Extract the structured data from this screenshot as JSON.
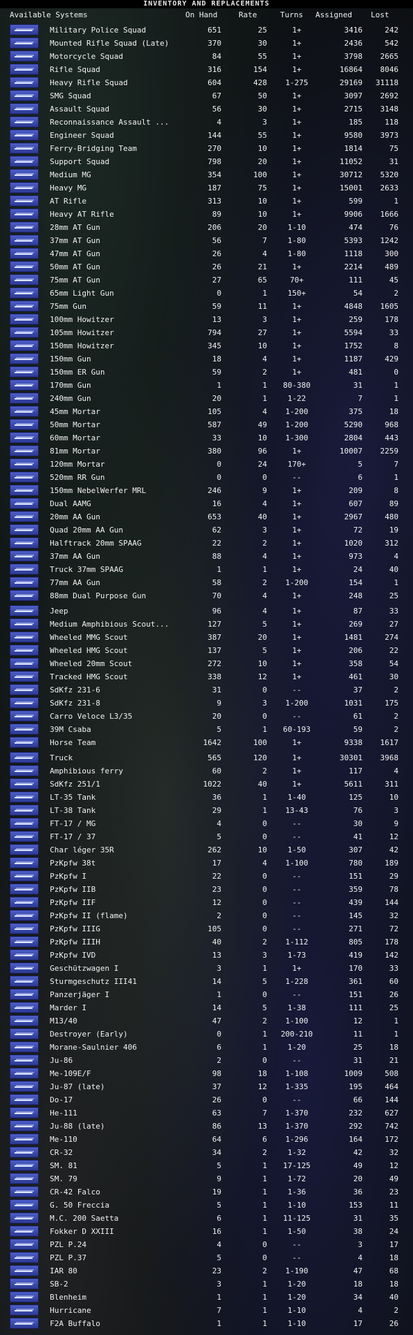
{
  "title": "INVENTORY AND REPLACEMENTS",
  "headers": {
    "name": "Available Systems",
    "on_hand": "On Hand",
    "rate": "Rate",
    "turns": "Turns",
    "assigned": "Assigned",
    "lost": "Lost"
  },
  "rows": [
    {
      "name": "Military Police Squad",
      "on_hand": "651",
      "rate": "25",
      "turns": "1+",
      "assigned": "3416",
      "lost": "242"
    },
    {
      "name": "Mounted Rifle Squad (Late)",
      "on_hand": "370",
      "rate": "30",
      "turns": "1+",
      "assigned": "2436",
      "lost": "542"
    },
    {
      "name": "Motorcycle Squad",
      "on_hand": "84",
      "rate": "55",
      "turns": "1+",
      "assigned": "3798",
      "lost": "2665"
    },
    {
      "name": "Rifle Squad",
      "on_hand": "316",
      "rate": "154",
      "turns": "1+",
      "assigned": "16864",
      "lost": "8046"
    },
    {
      "name": "Heavy Rifle Squad",
      "on_hand": "604",
      "rate": "428",
      "turns": "1-275",
      "assigned": "29169",
      "lost": "31118"
    },
    {
      "name": "SMG Squad",
      "on_hand": "67",
      "rate": "50",
      "turns": "1+",
      "assigned": "3097",
      "lost": "2692"
    },
    {
      "name": "Assault Squad",
      "on_hand": "56",
      "rate": "30",
      "turns": "1+",
      "assigned": "2715",
      "lost": "3148"
    },
    {
      "name": "Reconnaissance Assault ...",
      "on_hand": "4",
      "rate": "3",
      "turns": "1+",
      "assigned": "185",
      "lost": "118"
    },
    {
      "name": "Engineer Squad",
      "on_hand": "144",
      "rate": "55",
      "turns": "1+",
      "assigned": "9580",
      "lost": "3973"
    },
    {
      "name": "Ferry-Bridging Team",
      "on_hand": "270",
      "rate": "10",
      "turns": "1+",
      "assigned": "1814",
      "lost": "75"
    },
    {
      "name": "Support Squad",
      "on_hand": "798",
      "rate": "20",
      "turns": "1+",
      "assigned": "11052",
      "lost": "31"
    },
    {
      "name": "Medium MG",
      "on_hand": "354",
      "rate": "100",
      "turns": "1+",
      "assigned": "30712",
      "lost": "5320"
    },
    {
      "name": "Heavy MG",
      "on_hand": "187",
      "rate": "75",
      "turns": "1+",
      "assigned": "15001",
      "lost": "2633"
    },
    {
      "name": "AT Rifle",
      "on_hand": "313",
      "rate": "10",
      "turns": "1+",
      "assigned": "599",
      "lost": "1"
    },
    {
      "name": "Heavy AT Rifle",
      "on_hand": "89",
      "rate": "10",
      "turns": "1+",
      "assigned": "9906",
      "lost": "1666"
    },
    {
      "name": "28mm AT Gun",
      "on_hand": "206",
      "rate": "20",
      "turns": "1-10",
      "assigned": "474",
      "lost": "76"
    },
    {
      "name": "37mm AT Gun",
      "on_hand": "56",
      "rate": "7",
      "turns": "1-80",
      "assigned": "5393",
      "lost": "1242"
    },
    {
      "name": "47mm AT Gun",
      "on_hand": "26",
      "rate": "4",
      "turns": "1-80",
      "assigned": "1118",
      "lost": "300"
    },
    {
      "name": "50mm AT Gun",
      "on_hand": "26",
      "rate": "21",
      "turns": "1+",
      "assigned": "2214",
      "lost": "489"
    },
    {
      "name": "75mm AT Gun",
      "on_hand": "27",
      "rate": "65",
      "turns": "70+",
      "assigned": "111",
      "lost": "45"
    },
    {
      "name": "65mm Light Gun",
      "on_hand": "0",
      "rate": "1",
      "turns": "150+",
      "assigned": "54",
      "lost": "2"
    },
    {
      "name": "75mm Gun",
      "on_hand": "59",
      "rate": "11",
      "turns": "1+",
      "assigned": "4848",
      "lost": "1605"
    },
    {
      "name": "100mm Howitzer",
      "on_hand": "13",
      "rate": "3",
      "turns": "1+",
      "assigned": "259",
      "lost": "178"
    },
    {
      "name": "105mm Howitzer",
      "on_hand": "794",
      "rate": "27",
      "turns": "1+",
      "assigned": "5594",
      "lost": "33"
    },
    {
      "name": "150mm Howitzer",
      "on_hand": "345",
      "rate": "10",
      "turns": "1+",
      "assigned": "1752",
      "lost": "8"
    },
    {
      "name": "150mm Gun",
      "on_hand": "18",
      "rate": "4",
      "turns": "1+",
      "assigned": "1187",
      "lost": "429"
    },
    {
      "name": "150mm ER Gun",
      "on_hand": "59",
      "rate": "2",
      "turns": "1+",
      "assigned": "481",
      "lost": "0"
    },
    {
      "name": "170mm Gun",
      "on_hand": "1",
      "rate": "1",
      "turns": "80-380",
      "assigned": "31",
      "lost": "1"
    },
    {
      "name": "240mm Gun",
      "on_hand": "20",
      "rate": "1",
      "turns": "1-22",
      "assigned": "7",
      "lost": "1"
    },
    {
      "name": "45mm Mortar",
      "on_hand": "105",
      "rate": "4",
      "turns": "1-200",
      "assigned": "375",
      "lost": "18"
    },
    {
      "name": "50mm Mortar",
      "on_hand": "587",
      "rate": "49",
      "turns": "1-200",
      "assigned": "5290",
      "lost": "968"
    },
    {
      "name": "60mm Mortar",
      "on_hand": "33",
      "rate": "10",
      "turns": "1-300",
      "assigned": "2804",
      "lost": "443"
    },
    {
      "name": "81mm Mortar",
      "on_hand": "380",
      "rate": "96",
      "turns": "1+",
      "assigned": "10007",
      "lost": "2259"
    },
    {
      "name": "120mm Mortar",
      "on_hand": "0",
      "rate": "24",
      "turns": "170+",
      "assigned": "5",
      "lost": "7"
    },
    {
      "name": "520mm RR Gun",
      "on_hand": "0",
      "rate": "0",
      "turns": "--",
      "assigned": "6",
      "lost": "1"
    },
    {
      "name": "150mm NebelWerfer MRL",
      "on_hand": "246",
      "rate": "9",
      "turns": "1+",
      "assigned": "209",
      "lost": "8"
    },
    {
      "name": "Dual AAMG",
      "on_hand": "16",
      "rate": "4",
      "turns": "1+",
      "assigned": "607",
      "lost": "89"
    },
    {
      "name": "20mm AA Gun",
      "on_hand": "653",
      "rate": "40",
      "turns": "1+",
      "assigned": "2967",
      "lost": "480"
    },
    {
      "name": "Quad 20mm AA Gun",
      "on_hand": "62",
      "rate": "3",
      "turns": "1+",
      "assigned": "72",
      "lost": "19"
    },
    {
      "name": "Halftrack 20mm SPAAG",
      "on_hand": "22",
      "rate": "2",
      "turns": "1+",
      "assigned": "1020",
      "lost": "312"
    },
    {
      "name": "37mm AA Gun",
      "on_hand": "88",
      "rate": "4",
      "turns": "1+",
      "assigned": "973",
      "lost": "4"
    },
    {
      "name": "Truck 37mm SPAAG",
      "on_hand": "1",
      "rate": "1",
      "turns": "1+",
      "assigned": "24",
      "lost": "40"
    },
    {
      "name": "77mm AA Gun",
      "on_hand": "58",
      "rate": "2",
      "turns": "1-200",
      "assigned": "154",
      "lost": "1"
    },
    {
      "name": "88mm Dual Purpose Gun",
      "on_hand": "70",
      "rate": "4",
      "turns": "1+",
      "assigned": "248",
      "lost": "25"
    },
    {
      "name": "Jeep",
      "on_hand": "96",
      "rate": "4",
      "turns": "1+",
      "assigned": "87",
      "lost": "33",
      "sep": true
    },
    {
      "name": "Medium Amphibious Scout...",
      "on_hand": "127",
      "rate": "5",
      "turns": "1+",
      "assigned": "269",
      "lost": "27"
    },
    {
      "name": "Wheeled MMG Scout",
      "on_hand": "387",
      "rate": "20",
      "turns": "1+",
      "assigned": "1481",
      "lost": "274"
    },
    {
      "name": "Wheeled HMG Scout",
      "on_hand": "137",
      "rate": "5",
      "turns": "1+",
      "assigned": "206",
      "lost": "22"
    },
    {
      "name": "Wheeled 20mm Scout",
      "on_hand": "272",
      "rate": "10",
      "turns": "1+",
      "assigned": "358",
      "lost": "54"
    },
    {
      "name": "Tracked HMG Scout",
      "on_hand": "338",
      "rate": "12",
      "turns": "1+",
      "assigned": "461",
      "lost": "30"
    },
    {
      "name": "SdKfz 231-6",
      "on_hand": "31",
      "rate": "0",
      "turns": "--",
      "assigned": "37",
      "lost": "2"
    },
    {
      "name": "SdKfz 231-8",
      "on_hand": "9",
      "rate": "3",
      "turns": "1-200",
      "assigned": "1031",
      "lost": "175"
    },
    {
      "name": "Carro Veloce L3/35",
      "on_hand": "20",
      "rate": "0",
      "turns": "--",
      "assigned": "61",
      "lost": "2"
    },
    {
      "name": "39M Csaba",
      "on_hand": "5",
      "rate": "1",
      "turns": "60-193",
      "assigned": "59",
      "lost": "2"
    },
    {
      "name": "Horse Team",
      "on_hand": "1642",
      "rate": "100",
      "turns": "1+",
      "assigned": "9338",
      "lost": "1617"
    },
    {
      "name": "Truck",
      "on_hand": "565",
      "rate": "120",
      "turns": "1+",
      "assigned": "30301",
      "lost": "3968",
      "sep": true
    },
    {
      "name": "Amphibious ferry",
      "on_hand": "60",
      "rate": "2",
      "turns": "1+",
      "assigned": "117",
      "lost": "4"
    },
    {
      "name": "SdKfz 251/1",
      "on_hand": "1022",
      "rate": "40",
      "turns": "1+",
      "assigned": "5611",
      "lost": "311"
    },
    {
      "name": "LT-35 Tank",
      "on_hand": "36",
      "rate": "1",
      "turns": "1-40",
      "assigned": "125",
      "lost": "10"
    },
    {
      "name": "LT-38 Tank",
      "on_hand": "29",
      "rate": "1",
      "turns": "13-43",
      "assigned": "76",
      "lost": "3"
    },
    {
      "name": "FT-17 / MG",
      "on_hand": "4",
      "rate": "0",
      "turns": "--",
      "assigned": "30",
      "lost": "9"
    },
    {
      "name": "FT-17 / 37",
      "on_hand": "5",
      "rate": "0",
      "turns": "--",
      "assigned": "41",
      "lost": "12"
    },
    {
      "name": "Char léger 35R",
      "on_hand": "262",
      "rate": "10",
      "turns": "1-50",
      "assigned": "307",
      "lost": "42"
    },
    {
      "name": "PzKpfw 38t",
      "on_hand": "17",
      "rate": "4",
      "turns": "1-100",
      "assigned": "780",
      "lost": "189"
    },
    {
      "name": "PzKpfw I",
      "on_hand": "22",
      "rate": "0",
      "turns": "--",
      "assigned": "151",
      "lost": "29"
    },
    {
      "name": "PzKpfw IIB",
      "on_hand": "23",
      "rate": "0",
      "turns": "--",
      "assigned": "359",
      "lost": "78"
    },
    {
      "name": "PzKpfw IIF",
      "on_hand": "12",
      "rate": "0",
      "turns": "--",
      "assigned": "439",
      "lost": "144"
    },
    {
      "name": "PzKpfw II (flame)",
      "on_hand": "2",
      "rate": "0",
      "turns": "--",
      "assigned": "145",
      "lost": "32"
    },
    {
      "name": "PzKpfw IIIG",
      "on_hand": "105",
      "rate": "0",
      "turns": "--",
      "assigned": "271",
      "lost": "72"
    },
    {
      "name": "PzKpfw IIIH",
      "on_hand": "40",
      "rate": "2",
      "turns": "1-112",
      "assigned": "805",
      "lost": "178"
    },
    {
      "name": "PzKpfw IVD",
      "on_hand": "13",
      "rate": "3",
      "turns": "1-73",
      "assigned": "419",
      "lost": "142"
    },
    {
      "name": "Geschützwagen I",
      "on_hand": "3",
      "rate": "1",
      "turns": "1+",
      "assigned": "170",
      "lost": "33"
    },
    {
      "name": "Sturmgeschutz III41",
      "on_hand": "14",
      "rate": "5",
      "turns": "1-228",
      "assigned": "361",
      "lost": "60"
    },
    {
      "name": "Panzerjäger I",
      "on_hand": "1",
      "rate": "0",
      "turns": "--",
      "assigned": "151",
      "lost": "26"
    },
    {
      "name": "Marder I",
      "on_hand": "14",
      "rate": "5",
      "turns": "1-38",
      "assigned": "111",
      "lost": "25"
    },
    {
      "name": "M13/40",
      "on_hand": "47",
      "rate": "2",
      "turns": "1-100",
      "assigned": "12",
      "lost": "1"
    },
    {
      "name": "Destroyer (Early)",
      "on_hand": "0",
      "rate": "1",
      "turns": "200-210",
      "assigned": "11",
      "lost": "1"
    },
    {
      "name": "Morane-Saulnier 406",
      "on_hand": "6",
      "rate": "1",
      "turns": "1-20",
      "assigned": "25",
      "lost": "18"
    },
    {
      "name": "Ju-86",
      "on_hand": "2",
      "rate": "0",
      "turns": "--",
      "assigned": "31",
      "lost": "21"
    },
    {
      "name": "Me-109E/F",
      "on_hand": "98",
      "rate": "18",
      "turns": "1-108",
      "assigned": "1009",
      "lost": "508"
    },
    {
      "name": "Ju-87 (late)",
      "on_hand": "37",
      "rate": "12",
      "turns": "1-335",
      "assigned": "195",
      "lost": "464"
    },
    {
      "name": "Do-17",
      "on_hand": "26",
      "rate": "0",
      "turns": "--",
      "assigned": "66",
      "lost": "144"
    },
    {
      "name": "He-111",
      "on_hand": "63",
      "rate": "7",
      "turns": "1-370",
      "assigned": "232",
      "lost": "627"
    },
    {
      "name": "Ju-88 (late)",
      "on_hand": "86",
      "rate": "13",
      "turns": "1-370",
      "assigned": "292",
      "lost": "742"
    },
    {
      "name": "Me-110",
      "on_hand": "64",
      "rate": "6",
      "turns": "1-296",
      "assigned": "164",
      "lost": "172"
    },
    {
      "name": "CR-32",
      "on_hand": "34",
      "rate": "2",
      "turns": "1-32",
      "assigned": "42",
      "lost": "32"
    },
    {
      "name": "SM. 81",
      "on_hand": "5",
      "rate": "1",
      "turns": "17-125",
      "assigned": "49",
      "lost": "12"
    },
    {
      "name": "SM. 79",
      "on_hand": "9",
      "rate": "1",
      "turns": "1-72",
      "assigned": "20",
      "lost": "49"
    },
    {
      "name": "CR-42 Falco",
      "on_hand": "19",
      "rate": "1",
      "turns": "1-36",
      "assigned": "36",
      "lost": "23"
    },
    {
      "name": "G. 50 Freccia",
      "on_hand": "5",
      "rate": "1",
      "turns": "1-10",
      "assigned": "153",
      "lost": "11"
    },
    {
      "name": "M.C. 200 Saetta",
      "on_hand": "6",
      "rate": "1",
      "turns": "11-125",
      "assigned": "31",
      "lost": "35"
    },
    {
      "name": "Fokker D XXIII",
      "on_hand": "16",
      "rate": "1",
      "turns": "1-50",
      "assigned": "38",
      "lost": "24"
    },
    {
      "name": "PZL P.24",
      "on_hand": "4",
      "rate": "0",
      "turns": "--",
      "assigned": "3",
      "lost": "17"
    },
    {
      "name": "PZL P.37",
      "on_hand": "5",
      "rate": "0",
      "turns": "--",
      "assigned": "4",
      "lost": "18"
    },
    {
      "name": "IAR 80",
      "on_hand": "23",
      "rate": "2",
      "turns": "1-190",
      "assigned": "47",
      "lost": "68"
    },
    {
      "name": "SB-2",
      "on_hand": "3",
      "rate": "1",
      "turns": "1-20",
      "assigned": "18",
      "lost": "18"
    },
    {
      "name": "Blenheim",
      "on_hand": "1",
      "rate": "1",
      "turns": "1-20",
      "assigned": "34",
      "lost": "40"
    },
    {
      "name": "Hurricane",
      "on_hand": "7",
      "rate": "1",
      "turns": "1-10",
      "assigned": "4",
      "lost": "2"
    },
    {
      "name": "F2A Buffalo",
      "on_hand": "1",
      "rate": "1",
      "turns": "1-10",
      "assigned": "17",
      "lost": "26"
    }
  ]
}
